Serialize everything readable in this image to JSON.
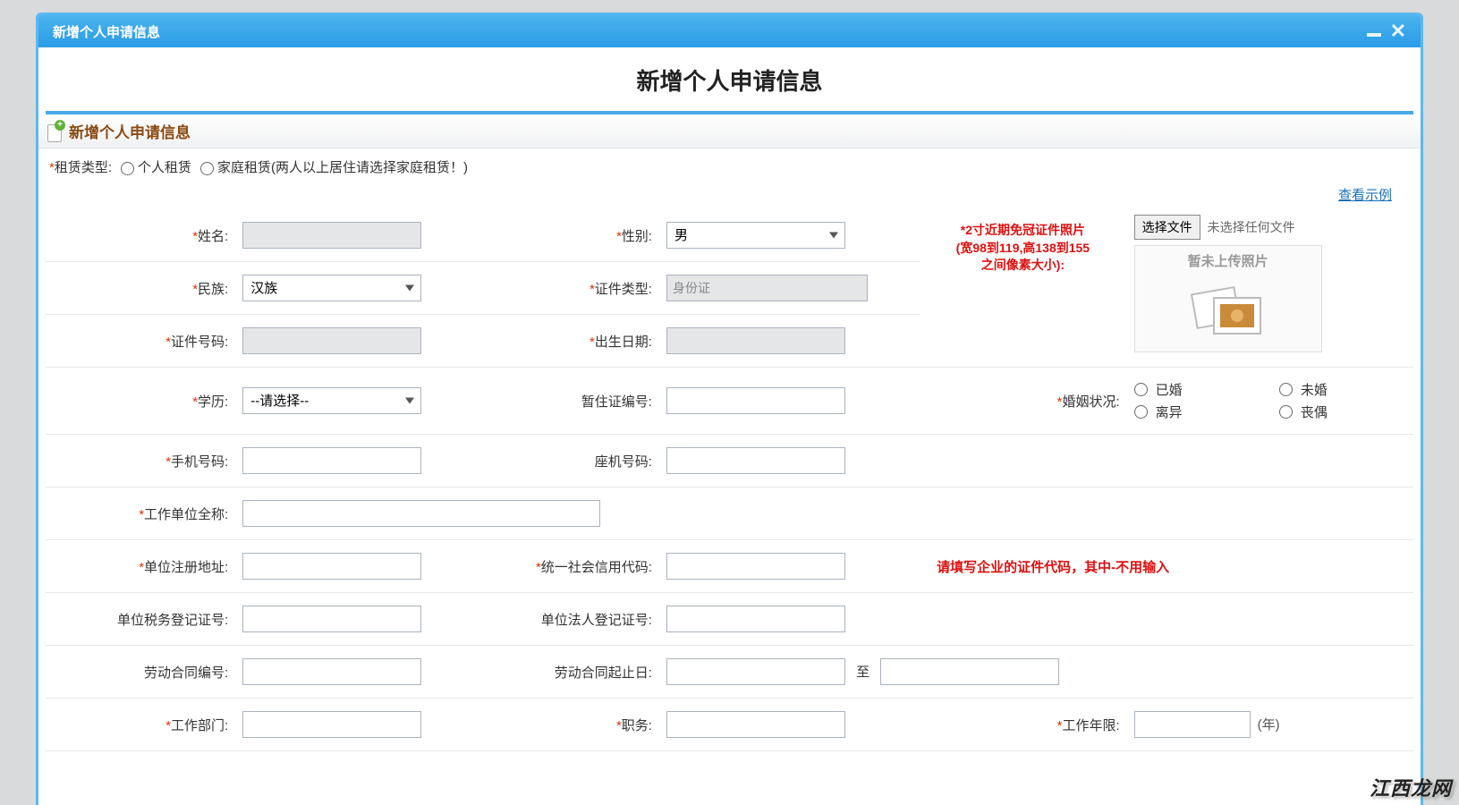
{
  "dialog": {
    "title": "新增个人申请信息"
  },
  "page": {
    "heading": "新增个人申请信息",
    "section_title": "新增个人申请信息",
    "example_link": "查看示例"
  },
  "lease": {
    "label": "租赁类型:",
    "option_personal": "个人租赁",
    "option_family": "家庭租赁(两人以上居住请选择家庭租赁！)"
  },
  "photo": {
    "hint_line1": "*2寸近期免冠证件照片",
    "hint_line2": "(宽98到119,高138到155",
    "hint_line3": "之间像素大小):",
    "choose_btn": "选择文件",
    "no_file": "未选择任何文件",
    "placeholder_text": "暂未上传照片"
  },
  "labels": {
    "name": "姓名:",
    "gender": "性别:",
    "ethnic": "民族:",
    "cert_type": "证件类型:",
    "cert_no": "证件号码:",
    "dob": "出生日期:",
    "edu": "学历:",
    "temp_no": "暂住证编号:",
    "marital": "婚姻状况:",
    "mobile": "手机号码:",
    "landline": "座机号码:",
    "company": "工作单位全称:",
    "reg_addr": "单位注册地址:",
    "uscc": "统一社会信用代码:",
    "tax_no": "单位税务登记证号:",
    "legal_no": "单位法人登记证号:",
    "contract_no": "劳动合同编号:",
    "contract_dates": "劳动合同起止日:",
    "dept": "工作部门:",
    "position": "职务:",
    "years": "工作年限:"
  },
  "values": {
    "gender": "男",
    "ethnic": "汉族",
    "cert_type": "身份证",
    "edu": "--请选择--",
    "to": "至",
    "year_unit": "(年)"
  },
  "marital": {
    "married": "已婚",
    "single": "未婚",
    "divorced": "离异",
    "widowed": "丧偶"
  },
  "hints": {
    "uscc": "请填写企业的证件代码，其中-不用输入"
  },
  "watermark": "江西龙网"
}
